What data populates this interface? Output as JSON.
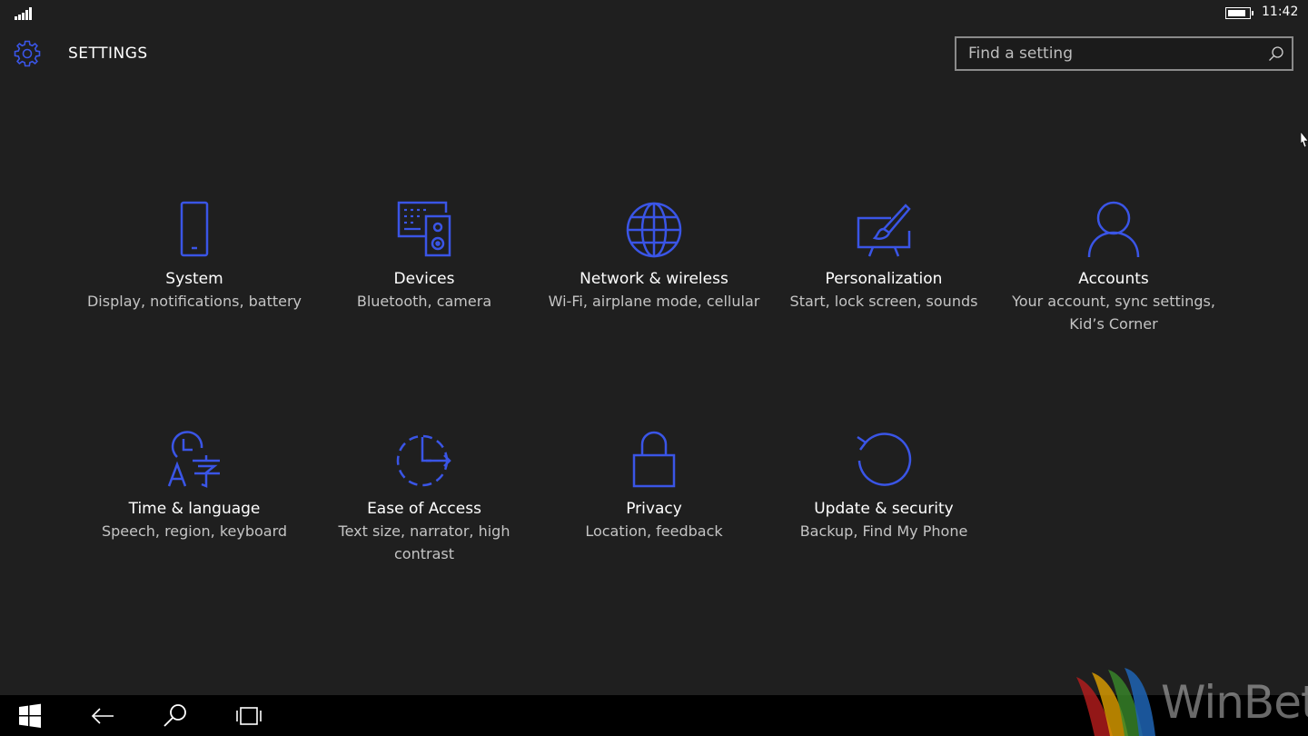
{
  "status_bar": {
    "time": "11:42",
    "signal_bars": 5,
    "battery_level": 0.9
  },
  "header": {
    "title": "SETTINGS",
    "icon": "gear-icon",
    "search": {
      "placeholder": "Find a setting",
      "value": ""
    }
  },
  "categories": [
    {
      "name": "System",
      "description": "Display, notifications, battery",
      "icon": "phone-icon"
    },
    {
      "name": "Devices",
      "description": "Bluetooth, camera",
      "icon": "devices-icon"
    },
    {
      "name": "Network & wireless",
      "description": "Wi-Fi, airplane mode, cellular",
      "icon": "globe-icon"
    },
    {
      "name": "Personalization",
      "description": "Start, lock screen, sounds",
      "icon": "paintbrush-icon"
    },
    {
      "name": "Accounts",
      "description": "Your account, sync settings, Kid’s Corner",
      "icon": "person-icon"
    },
    {
      "name": "Time & language",
      "description": "Speech, region, keyboard",
      "icon": "time-language-icon"
    },
    {
      "name": "Ease of Access",
      "description": "Text size, narrator, high contrast",
      "icon": "ease-of-access-icon"
    },
    {
      "name": "Privacy",
      "description": "Location, feedback",
      "icon": "lock-icon"
    },
    {
      "name": "Update & security",
      "description": "Backup, Find My Phone",
      "icon": "refresh-icon"
    }
  ],
  "taskbar": {
    "buttons": [
      "windows-icon",
      "back-arrow-icon",
      "search-icon",
      "task-view-icon"
    ]
  },
  "watermark": {
    "text": "WinBeta"
  },
  "colors": {
    "accent": "#3a55e6",
    "background": "#1f1f1f",
    "taskbar": "#000000",
    "secondary_text": "#c4c4c4"
  }
}
